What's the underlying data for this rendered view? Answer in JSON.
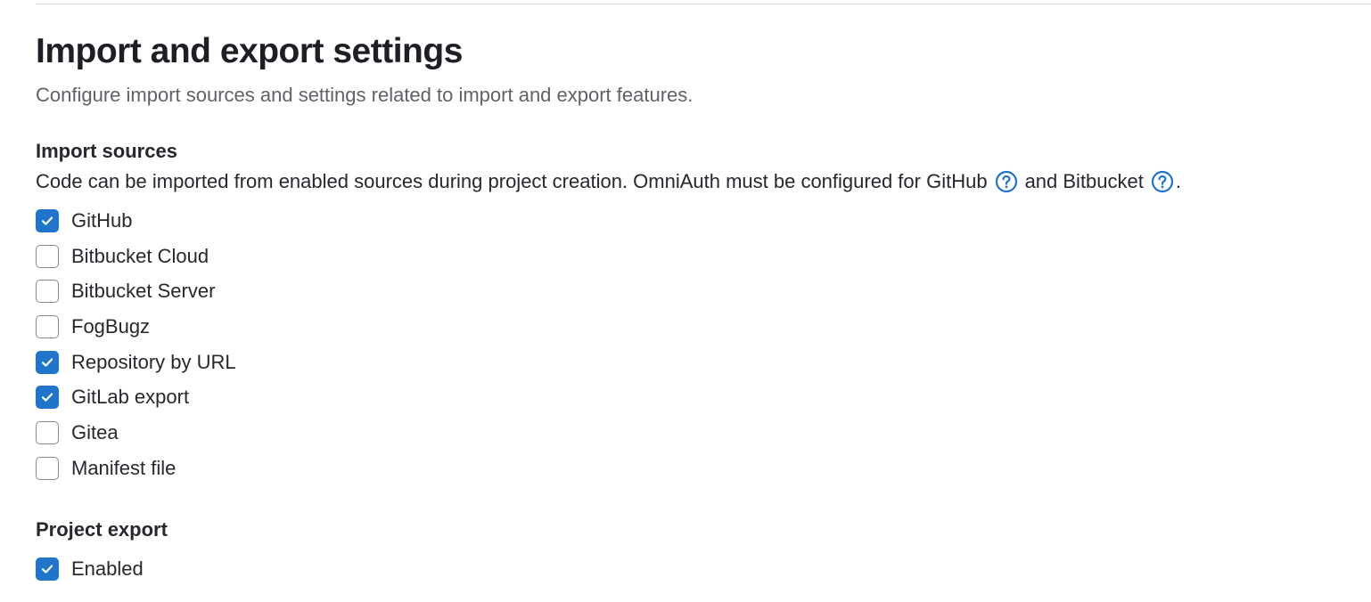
{
  "page": {
    "title": "Import and export settings",
    "description": "Configure import sources and settings related to import and export features."
  },
  "import_sources": {
    "heading": "Import sources",
    "description_prefix": "Code can be imported from enabled sources during project creation. OmniAuth must be configured for GitHub",
    "description_middle": "and Bitbucket",
    "description_suffix": ".",
    "help_icon": "question-circle-icon",
    "options": [
      {
        "label": "GitHub",
        "checked": true
      },
      {
        "label": "Bitbucket Cloud",
        "checked": false
      },
      {
        "label": "Bitbucket Server",
        "checked": false
      },
      {
        "label": "FogBugz",
        "checked": false
      },
      {
        "label": "Repository by URL",
        "checked": true
      },
      {
        "label": "GitLab export",
        "checked": true
      },
      {
        "label": "Gitea",
        "checked": false
      },
      {
        "label": "Manifest file",
        "checked": false
      }
    ]
  },
  "project_export": {
    "heading": "Project export",
    "options": [
      {
        "label": "Enabled",
        "checked": true
      }
    ]
  },
  "colors": {
    "accent": "#1f75cb",
    "text": "#28272d",
    "muted_text": "#626168",
    "checkbox_border": "#89888d",
    "divider": "#dcdcde"
  }
}
